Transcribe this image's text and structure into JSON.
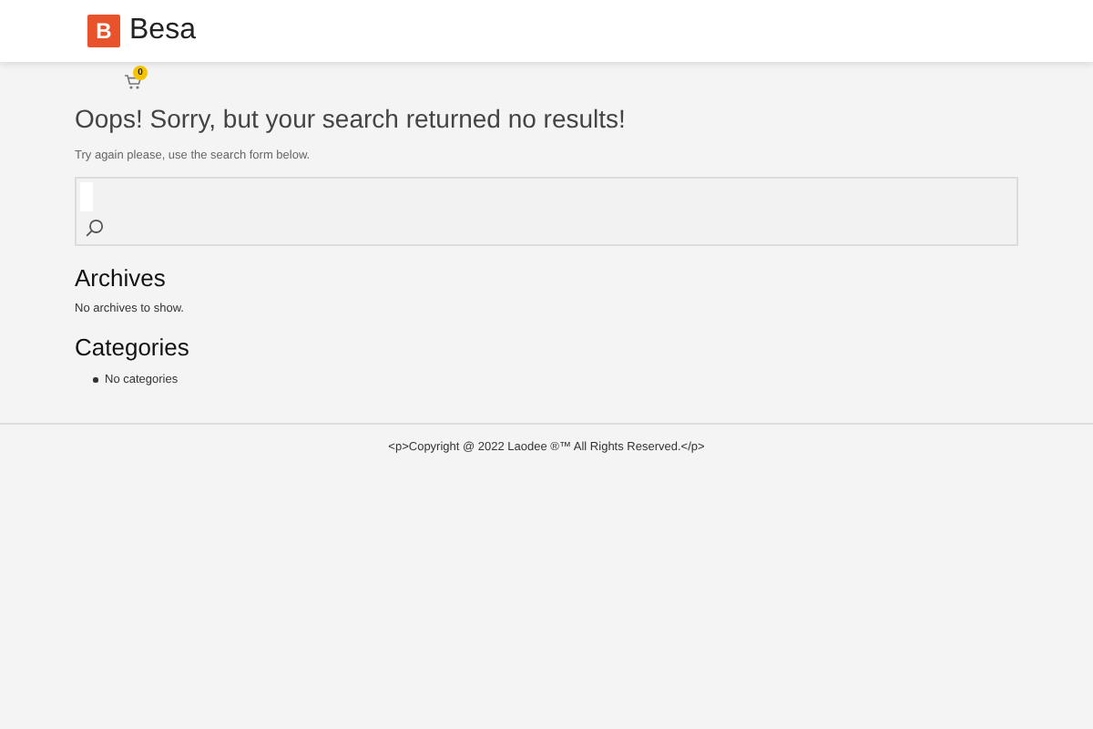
{
  "header": {
    "logo_letter": "B",
    "brand": "Besa"
  },
  "cart": {
    "count": "0"
  },
  "heading": "Oops! Sorry, but your search returned no results!",
  "subtext": "Try again please, use the search form below.",
  "archives": {
    "title": "Archives",
    "text": "No archives to show."
  },
  "categories": {
    "title": "Categories",
    "items": [
      "No categories"
    ]
  },
  "footer": "<p>Copyright @ 2022 Laodee ®™ All Rights Reserved.</p>"
}
